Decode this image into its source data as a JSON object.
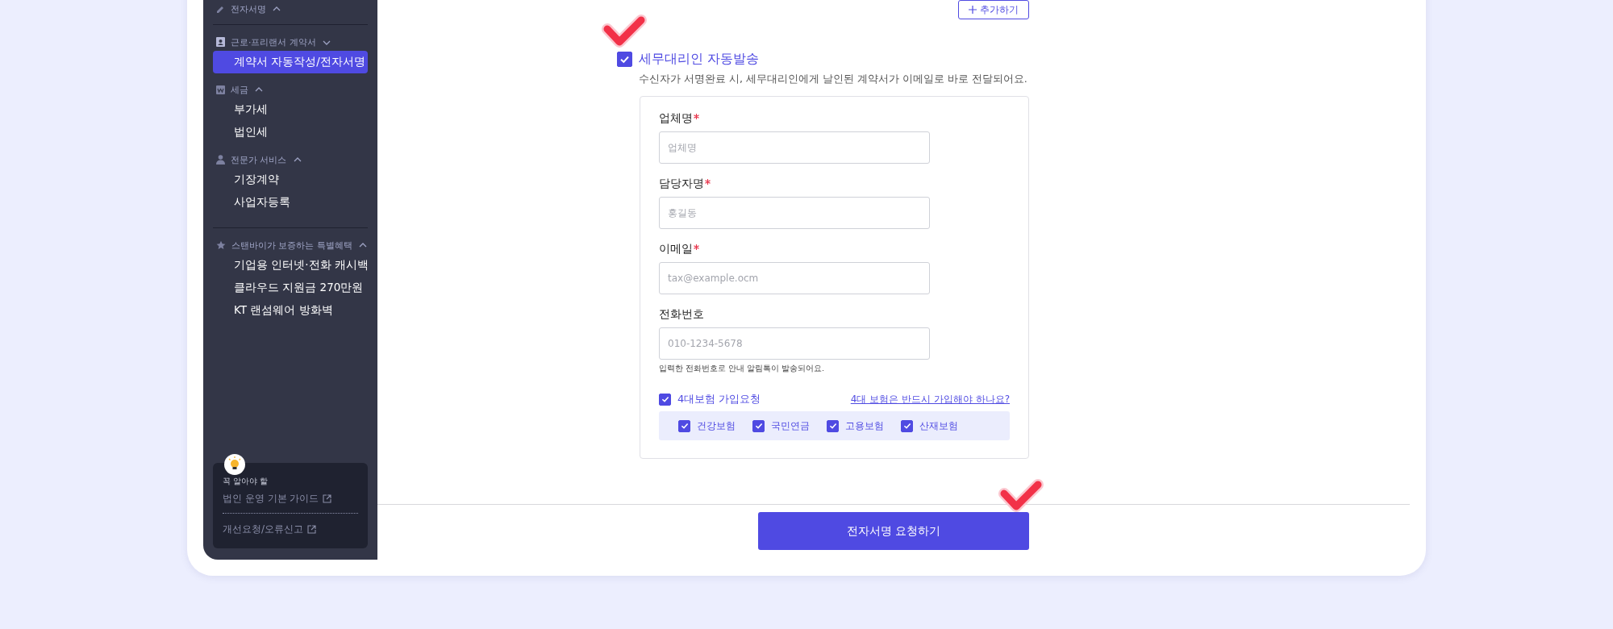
{
  "sidebar": {
    "top_item": {
      "label": "전자서명",
      "expanded": true
    },
    "sections": [
      {
        "kind": "contract",
        "title": "근로·프리랜서 계약서",
        "expanded": false,
        "items": [
          {
            "label": "계약서 자동작성/전자서명",
            "selected": true
          }
        ]
      },
      {
        "kind": "tax",
        "title": "세금",
        "expanded": true,
        "items": [
          {
            "label": "부가세",
            "selected": false
          },
          {
            "label": "법인세",
            "selected": false
          }
        ]
      },
      {
        "kind": "person",
        "title": "전문가 서비스",
        "expanded": true,
        "items": [
          {
            "label": "기장계약",
            "selected": false
          },
          {
            "label": "사업자등록",
            "selected": false
          }
        ]
      },
      {
        "kind": "star",
        "title": "스탠바이가 보증하는 특별혜택",
        "expanded": true,
        "divider_before": true,
        "items": [
          {
            "label": "기업용 인터넷·전화 캐시백",
            "selected": false
          },
          {
            "label": "클라우드 지원금 270만원",
            "selected": false
          },
          {
            "label": "KT 랜섬웨어 방화벽",
            "selected": false
          }
        ]
      }
    ],
    "help_card": {
      "heading": "꼭 알아야 할",
      "links": [
        "법인 운영 기본 가이드",
        "개선요청/오류신고"
      ]
    }
  },
  "main": {
    "add_button": "추가하기",
    "tax_agent": {
      "checked": true,
      "label": "세무대리인 자동발송",
      "description": "수신자가 서명완료 시, 세무대리인에게 날인된 계약서가 이메일로 바로 전달되어요."
    },
    "fields": [
      {
        "label": "업체명",
        "required": true,
        "placeholder": "업체명"
      },
      {
        "label": "담당자명",
        "required": true,
        "placeholder": "홍길동"
      },
      {
        "label": "이메일",
        "required": true,
        "placeholder": "tax@example.ocm"
      },
      {
        "label": "전화번호",
        "required": false,
        "placeholder": "010-1234-5678",
        "hint": "입력한 전화번호로 안내 알림톡이 발송되어요."
      }
    ],
    "insurance": {
      "checked": true,
      "label": "4대보험 가입요청",
      "link": "4대 보험은 반드시 가입해야 하나요?",
      "options": [
        {
          "label": "건강보험",
          "checked": true
        },
        {
          "label": "국민연금",
          "checked": true
        },
        {
          "label": "고용보험",
          "checked": true
        },
        {
          "label": "산재보험",
          "checked": true
        }
      ]
    },
    "submit_button": "전자서명 요청하기"
  }
}
